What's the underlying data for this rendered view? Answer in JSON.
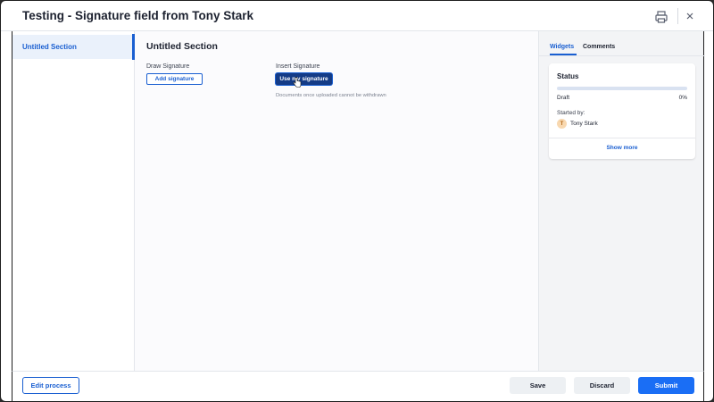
{
  "header": {
    "title": "Testing - Signature field from Tony Stark"
  },
  "sidebar": {
    "items": [
      {
        "label": "Untitled Section",
        "active": true
      }
    ]
  },
  "main": {
    "section_title": "Untitled Section",
    "draw_signature": {
      "label": "Draw Signature",
      "button_label": "Add signature"
    },
    "insert_signature": {
      "label": "Insert Signature",
      "button_label": "Use my signature",
      "helper_text": "Documents once uploaded cannot be withdrawn"
    }
  },
  "right_panel": {
    "tabs": [
      {
        "label": "Widgets",
        "active": true
      },
      {
        "label": "Comments",
        "active": false
      }
    ],
    "status_card": {
      "title": "Status",
      "status": "Draft",
      "progress_pct_label": "0%",
      "progress_fraction": 0,
      "started_by_label": "Started by:",
      "user_initial": "T",
      "user_name": "Tony Stark",
      "show_more_label": "Show more"
    }
  },
  "footer": {
    "edit_process_label": "Edit process",
    "save_label": "Save",
    "discard_label": "Discard",
    "submit_label": "Submit"
  },
  "icons": {
    "print": "printer-icon",
    "close": "close-icon",
    "cursor": "hand-pointer-icon"
  },
  "colors": {
    "accent": "#1a5fd1",
    "primary_button": "#1a6ef5",
    "insert_button": "#143b86",
    "avatar_bg": "#f8d8b0"
  }
}
